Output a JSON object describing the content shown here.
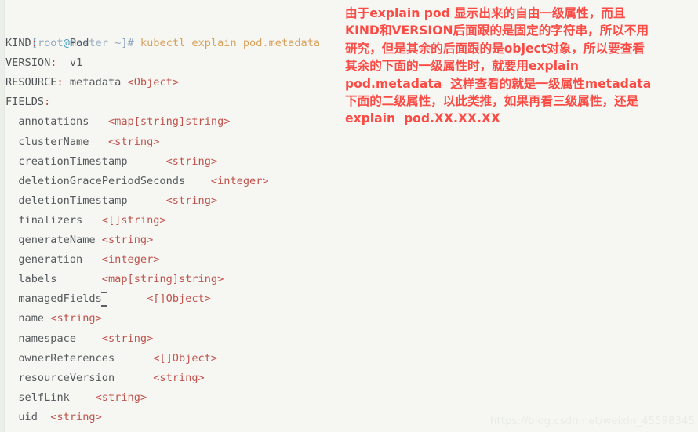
{
  "terminal": {
    "prompt": {
      "bracket_open": "[",
      "user": "root",
      "at": "@",
      "host": "master",
      "tail": " ~]# ",
      "command": "kubectl explain pod.metadata"
    },
    "header": [
      {
        "key": "KIND",
        "colon": ":",
        "pad": "     ",
        "value": "Pod"
      },
      {
        "key": "VERSION",
        "colon": ":",
        "pad": "  ",
        "value": "v1"
      },
      {
        "key": "RESOURCE",
        "colon": ":",
        "pad": " ",
        "value": "metadata ",
        "type": "<Object>"
      },
      {
        "key": "FIELDS",
        "colon": ":",
        "pad": "",
        "value": ""
      }
    ],
    "fields": [
      {
        "name": "annotations",
        "gap": "   ",
        "type": "<map[string]string>"
      },
      {
        "name": "clusterName",
        "gap": "   ",
        "type": "<string>"
      },
      {
        "name": "creationTimestamp",
        "gap": "      ",
        "type": "<string>"
      },
      {
        "name": "deletionGracePeriodSeconds",
        "gap": "    ",
        "type": "<integer>"
      },
      {
        "name": "deletionTimestamp",
        "gap": "      ",
        "type": "<string>"
      },
      {
        "name": "finalizers",
        "gap": "   ",
        "type": "<[]string>"
      },
      {
        "name": "generateName",
        "gap": " ",
        "type": "<string>"
      },
      {
        "name": "generation",
        "gap": "   ",
        "type": "<integer>"
      },
      {
        "name": "labels",
        "gap": "       ",
        "type": "<map[string]string>"
      },
      {
        "name": "managedFields",
        "gap": "       ",
        "type": "<[]Object>",
        "cursor": true
      },
      {
        "name": "name",
        "gap": " ",
        "type": "<string>"
      },
      {
        "name": "namespace",
        "gap": "    ",
        "type": "<string>"
      },
      {
        "name": "ownerReferences",
        "gap": "      ",
        "type": "<[]Object>"
      },
      {
        "name": "resourceVersion",
        "gap": "      ",
        "type": "<string>"
      },
      {
        "name": "selfLink",
        "gap": "    ",
        "type": "<string>"
      },
      {
        "name": "uid",
        "gap": "  ",
        "type": "<string>"
      }
    ],
    "field_indent": "  "
  },
  "annotation": {
    "color": "#fa4b45",
    "lines": [
      "由于explain pod 显示出来的自由一级属性，而且",
      "KIND和VERSION后面跟的是固定的字符串，所以不用",
      "研究，但是其余的后面跟的是object对象，所以要查看",
      "其余的下面的一级属性时，就要用explain",
      "pod.metadata  这样查看的就是一级属性metadata",
      "下面的二级属性，以此类推，如果再看三级属性，还是",
      "explain  pod.XX.XX.XX"
    ]
  },
  "watermark": {
    "text": "https://blog.csdn.net/weixin_45598345"
  },
  "colors": {
    "background": "#f6f7f3",
    "command": "#d9a05b",
    "prompt": "#8fa5bf",
    "field_name": "#55595c",
    "field_type": "#c0544e",
    "colon": "#d0413a",
    "annotation_red": "#fa4b45"
  }
}
